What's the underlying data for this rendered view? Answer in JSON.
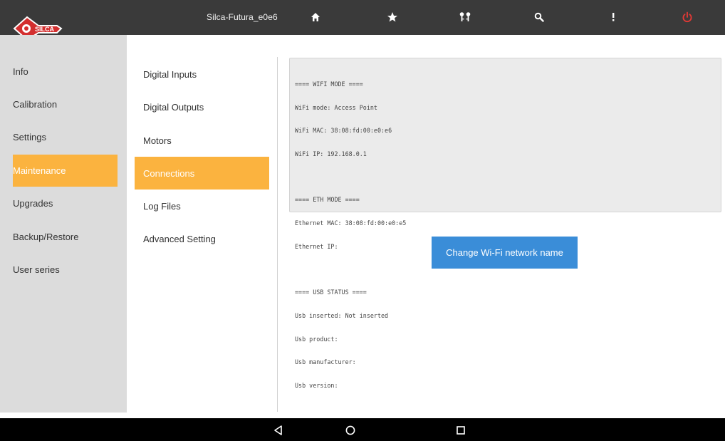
{
  "app": {
    "brand_logo_text": "SILCA",
    "device_name": "Silca-Futura_e0e6"
  },
  "toolbar": {
    "icons": [
      "home-icon",
      "star-icon",
      "keys-icon",
      "search-icon",
      "more-vertical-icon",
      "power-icon"
    ],
    "power_color": "#e53935"
  },
  "sidebar": {
    "items": [
      {
        "label": "Info",
        "active": false
      },
      {
        "label": "Calibration",
        "active": false
      },
      {
        "label": "Settings",
        "active": false
      },
      {
        "label": "Maintenance",
        "active": true
      },
      {
        "label": "Upgrades",
        "active": false
      },
      {
        "label": "Backup/Restore",
        "active": false
      },
      {
        "label": "User series",
        "active": false
      }
    ]
  },
  "submenu": {
    "items": [
      {
        "label": "Digital Inputs",
        "active": false
      },
      {
        "label": "Digital Outputs",
        "active": false
      },
      {
        "label": "Motors",
        "active": false
      },
      {
        "label": "Connections",
        "active": true
      },
      {
        "label": "Log Files",
        "active": false
      },
      {
        "label": "Advanced Setting",
        "active": false
      }
    ]
  },
  "connections": {
    "wifi_header": "==== WIFI MODE ====",
    "wifi_mode": "WiFi mode: Access Point",
    "wifi_mac": "WiFi MAC: 38:08:fd:00:e0:e6",
    "wifi_ip": "WiFi IP: 192.168.0.1",
    "eth_header": "==== ETH MODE ====",
    "eth_mac": "Ethernet MAC: 38:08:fd:00:e0:e5",
    "eth_ip": "Ethernet IP:",
    "usb_header": "==== USB STATUS ====",
    "usb_inserted": "Usb inserted: Not inserted",
    "usb_product": "Usb product:",
    "usb_manufacturer": "Usb manufacturer:",
    "usb_version": "Usb version:",
    "change_wifi_label": "Change Wi-Fi network name"
  },
  "android_nav": {
    "icons": [
      "back-icon",
      "home-circle-icon",
      "recents-icon"
    ]
  },
  "colors": {
    "accent_orange": "#fbb33f",
    "button_blue": "#3a8dd8",
    "topbar": "#3a3a3a",
    "sidebar_bg": "#dcdcdc",
    "brand_red": "#d32f2f"
  }
}
